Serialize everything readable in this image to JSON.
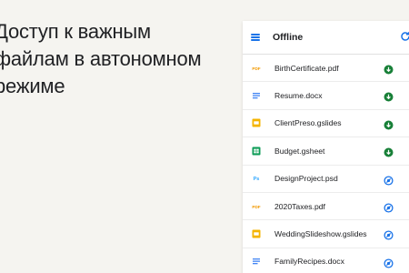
{
  "headline": "Доступ к важным\nфайлам в автономном\nрежиме",
  "appbar": {
    "title": "Offline",
    "menu_icon": "hamburger-menu-icon",
    "action_icon": "sync-icon"
  },
  "colors": {
    "accent": "#1a73e8",
    "pdf": "#f29900",
    "docs": "#4285f4",
    "slides": "#f4b400",
    "sheets": "#0f9d58",
    "photoshop": "#31a8ff",
    "downloaded": "#188038",
    "syncing": "#1a73e8"
  },
  "files": [
    {
      "name": "BirthCertificate.pdf",
      "type_icon": "pdf-file-icon",
      "type_label": "PDF",
      "status_icon": "downloaded-check-icon"
    },
    {
      "name": "Resume.docx",
      "type_icon": "docs-file-icon",
      "type_label": "",
      "status_icon": "downloaded-check-icon"
    },
    {
      "name": "ClientPreso.gslides",
      "type_icon": "slides-file-icon",
      "type_label": "",
      "status_icon": "downloaded-check-icon"
    },
    {
      "name": "Budget.gsheet",
      "type_icon": "sheets-file-icon",
      "type_label": "",
      "status_icon": "downloaded-check-icon"
    },
    {
      "name": "DesignProject.psd",
      "type_icon": "photoshop-file-icon",
      "type_label": "Ps",
      "status_icon": "sync-pending-icon"
    },
    {
      "name": "2020Taxes.pdf",
      "type_icon": "pdf-file-icon",
      "type_label": "PDF",
      "status_icon": "sync-pending-icon"
    },
    {
      "name": "WeddingSlideshow.gslides",
      "type_icon": "slides-file-icon",
      "type_label": "",
      "status_icon": "sync-pending-icon"
    },
    {
      "name": "FamilyRecipes.docx",
      "type_icon": "docs-file-icon",
      "type_label": "",
      "status_icon": "sync-pending-icon"
    }
  ]
}
